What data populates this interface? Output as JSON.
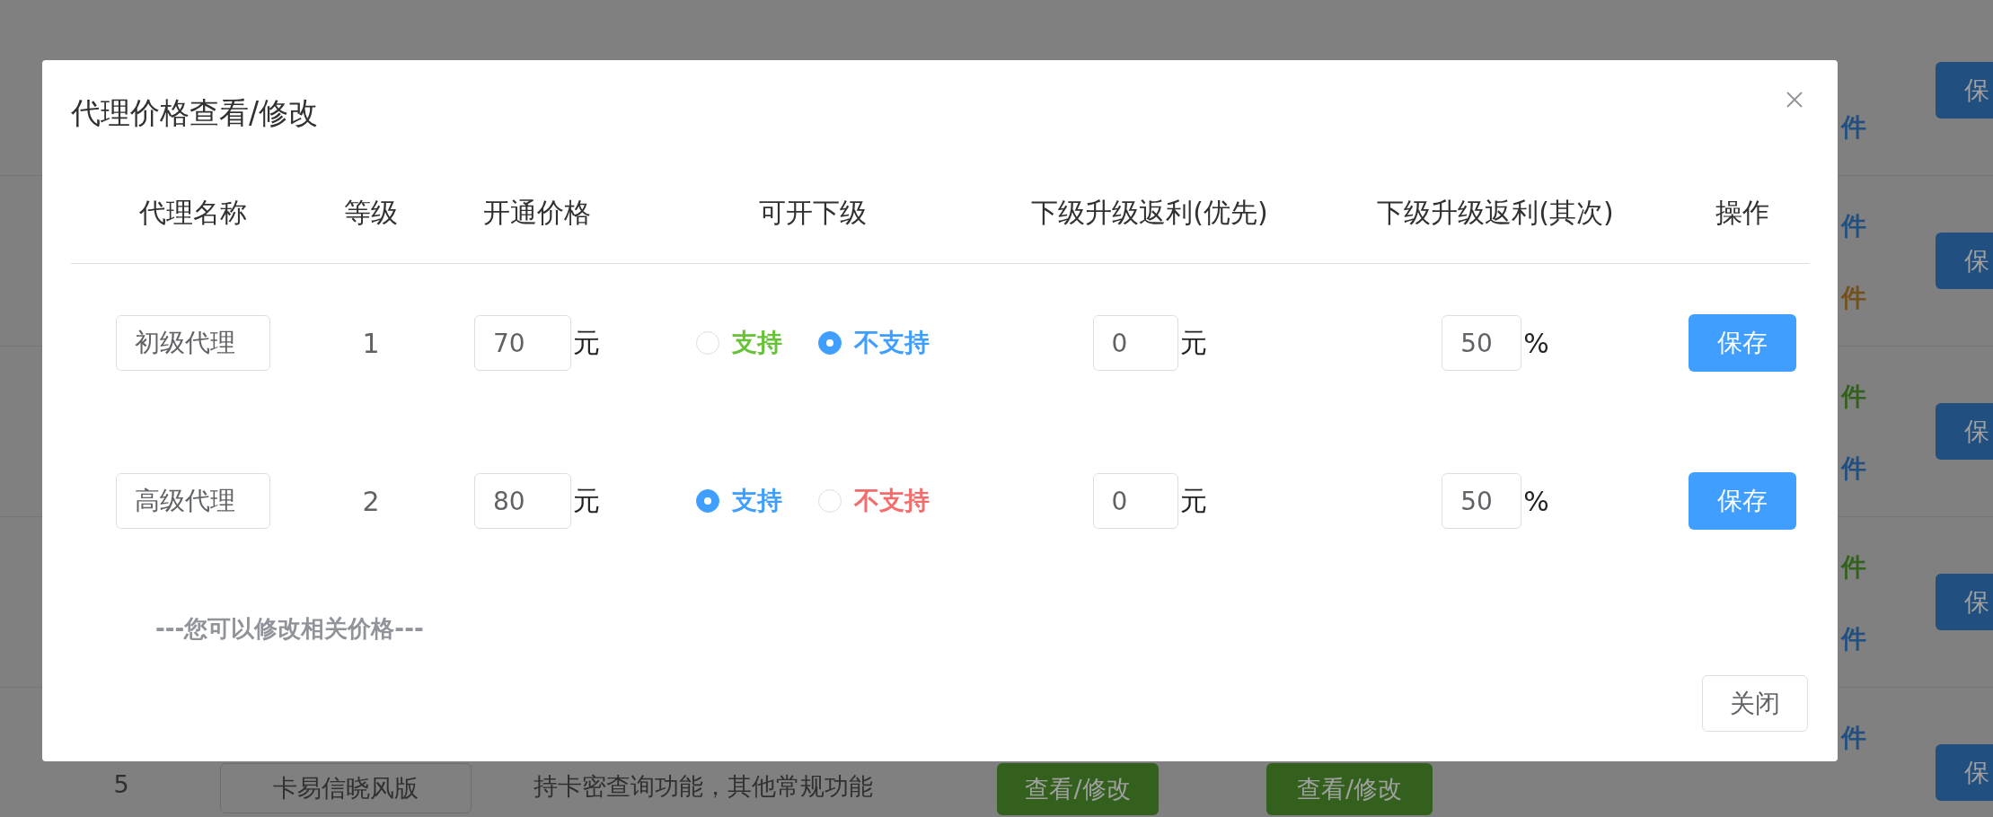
{
  "background": {
    "rows": [
      {
        "plugins": [
          {
            "kind": "text",
            "text": "件",
            "color": "#204f80"
          }
        ],
        "save": "保"
      },
      {
        "plugins": [
          {
            "kind": "text",
            "text": "件",
            "color": "#204f80"
          },
          {
            "kind": "text",
            "text": "件",
            "color": "#73511e"
          }
        ],
        "save": "保"
      },
      {
        "plugins": [
          {
            "kind": "text",
            "text": "件",
            "color": "#33611d"
          },
          {
            "kind": "text",
            "text": "件",
            "color": "#204f80"
          }
        ],
        "save": "保"
      },
      {
        "plugins": [
          {
            "kind": "text",
            "text": "件",
            "color": "#33611d"
          },
          {
            "kind": "text",
            "text": "件",
            "color": "#204f80"
          }
        ],
        "save": "保"
      },
      {
        "index": "5",
        "name": "卡易信晓风版",
        "description": "持卡密查询功能，其他常规功能",
        "view_buttons": [
          "查看/修改",
          "查看/修改"
        ],
        "plugins": [
          {
            "kind": "text",
            "text": "件",
            "color": "#204f80"
          }
        ],
        "save": "保"
      }
    ]
  },
  "dialog": {
    "title": "代理价格查看/修改",
    "columns": [
      "代理名称",
      "等级",
      "开通价格",
      "可开下级",
      "下级升级返利(优先)",
      "下级升级返利(其次)",
      "操作"
    ],
    "rows": [
      {
        "name": "初级代理",
        "level": "1",
        "price": "70",
        "price_unit": "元",
        "options": [
          {
            "label": "支持",
            "selected": false,
            "color": "#67c23a"
          },
          {
            "label": "不支持",
            "selected": true,
            "color": "#409eff"
          }
        ],
        "rebate_first": "0",
        "rebate_first_unit": "元",
        "rebate_second": "50",
        "rebate_second_unit": "%",
        "action": "保存"
      },
      {
        "name": "高级代理",
        "level": "2",
        "price": "80",
        "price_unit": "元",
        "options": [
          {
            "label": "支持",
            "selected": true,
            "color": "#409eff"
          },
          {
            "label": "不支持",
            "selected": false,
            "color": "#f56c6c"
          }
        ],
        "rebate_first": "0",
        "rebate_first_unit": "元",
        "rebate_second": "50",
        "rebate_second_unit": "%",
        "action": "保存"
      }
    ],
    "note": "---您可以修改相关价格---",
    "close_button": "关闭"
  }
}
